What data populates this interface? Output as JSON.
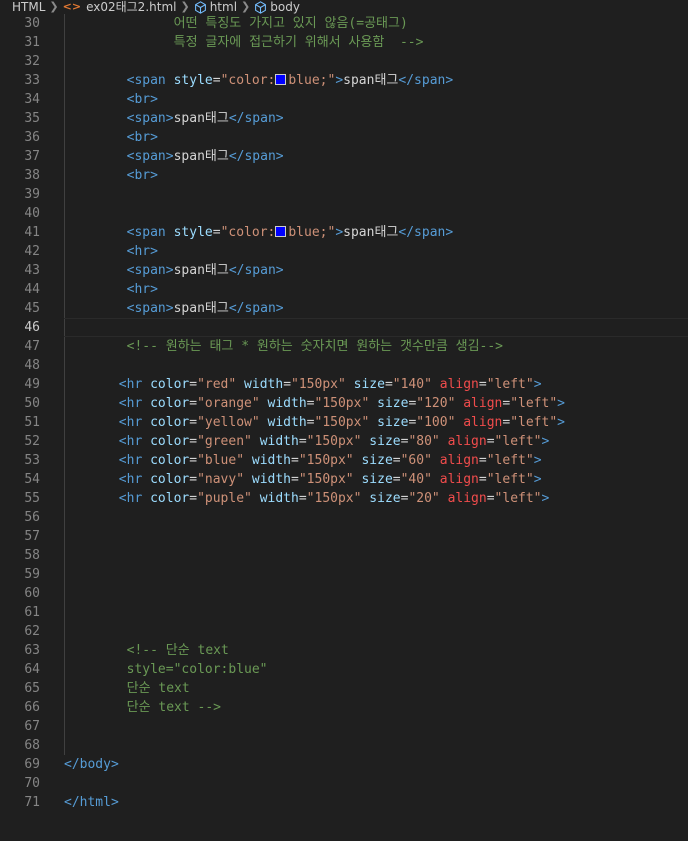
{
  "breadcrumb": {
    "items": [
      "HTML",
      "ex02태그2.html",
      "html",
      "body"
    ]
  },
  "colors": {
    "background": "#1f1f1f",
    "tag": "#569cd6",
    "attribute": "#9cdcfe",
    "string": "#ce9178",
    "invalid_attribute": "#f14c4c",
    "comment": "#6a9955",
    "swatch_blue": "#0000ff"
  },
  "editor": {
    "current_line": 46,
    "lines": [
      {
        "n": "30",
        "indent": 14,
        "tokens": [
          {
            "t": "어떤 특징도 가지고 있지 않음(=공태그)",
            "c": "cmt"
          }
        ]
      },
      {
        "n": "31",
        "indent": 14,
        "tokens": [
          {
            "t": "특정 글자에 접근하기 위해서 사용함  -->",
            "c": "cmt"
          }
        ]
      },
      {
        "n": "32",
        "indent": 0,
        "tokens": []
      },
      {
        "n": "33",
        "indent": 8,
        "tokens": [
          {
            "t": "<span",
            "c": "tag"
          },
          {
            "t": " "
          },
          {
            "t": "style",
            "c": "attr"
          },
          {
            "t": "=",
            "c": "txt"
          },
          {
            "t": "\"color:",
            "c": "str"
          },
          {
            "t": "",
            "c": "swatch"
          },
          {
            "t": "blue;\"",
            "c": "str"
          },
          {
            "t": ">",
            "c": "tag"
          },
          {
            "t": "span태그",
            "c": "txt"
          },
          {
            "t": "</span>",
            "c": "tag"
          }
        ]
      },
      {
        "n": "34",
        "indent": 8,
        "tokens": [
          {
            "t": "<br>",
            "c": "tag"
          }
        ]
      },
      {
        "n": "35",
        "indent": 8,
        "tokens": [
          {
            "t": "<span>",
            "c": "tag"
          },
          {
            "t": "span태그",
            "c": "txt"
          },
          {
            "t": "</span>",
            "c": "tag"
          }
        ]
      },
      {
        "n": "36",
        "indent": 8,
        "tokens": [
          {
            "t": "<br>",
            "c": "tag"
          }
        ]
      },
      {
        "n": "37",
        "indent": 8,
        "tokens": [
          {
            "t": "<span>",
            "c": "tag"
          },
          {
            "t": "span태그",
            "c": "txt"
          },
          {
            "t": "</span>",
            "c": "tag"
          }
        ]
      },
      {
        "n": "38",
        "indent": 8,
        "tokens": [
          {
            "t": "<br>",
            "c": "tag"
          }
        ]
      },
      {
        "n": "39",
        "indent": 0,
        "tokens": []
      },
      {
        "n": "40",
        "indent": 0,
        "tokens": []
      },
      {
        "n": "41",
        "indent": 8,
        "tokens": [
          {
            "t": "<span",
            "c": "tag"
          },
          {
            "t": " "
          },
          {
            "t": "style",
            "c": "attr"
          },
          {
            "t": "=",
            "c": "txt"
          },
          {
            "t": "\"color:",
            "c": "str"
          },
          {
            "t": "",
            "c": "swatch"
          },
          {
            "t": "blue;\"",
            "c": "str"
          },
          {
            "t": ">",
            "c": "tag"
          },
          {
            "t": "span태그",
            "c": "txt"
          },
          {
            "t": "</span>",
            "c": "tag"
          }
        ]
      },
      {
        "n": "42",
        "indent": 8,
        "tokens": [
          {
            "t": "<hr>",
            "c": "tag"
          }
        ]
      },
      {
        "n": "43",
        "indent": 8,
        "tokens": [
          {
            "t": "<span>",
            "c": "tag"
          },
          {
            "t": "span태그",
            "c": "txt"
          },
          {
            "t": "</span>",
            "c": "tag"
          }
        ]
      },
      {
        "n": "44",
        "indent": 8,
        "tokens": [
          {
            "t": "<hr>",
            "c": "tag"
          }
        ]
      },
      {
        "n": "45",
        "indent": 8,
        "tokens": [
          {
            "t": "<span>",
            "c": "tag"
          },
          {
            "t": "span태그",
            "c": "txt"
          },
          {
            "t": "</span>",
            "c": "tag"
          }
        ]
      },
      {
        "n": "46",
        "indent": 0,
        "tokens": []
      },
      {
        "n": "47",
        "indent": 8,
        "tokens": [
          {
            "t": "<!-- 원하는 태그 * 원하는 숫자치면 원하는 갯수만큼 생김-->",
            "c": "cmt"
          }
        ]
      },
      {
        "n": "48",
        "indent": 0,
        "tokens": []
      },
      {
        "n": "49",
        "indent": 7,
        "tokens": [
          {
            "t": "<hr",
            "c": "tag"
          },
          {
            "t": " "
          },
          {
            "t": "color",
            "c": "attr"
          },
          {
            "t": "=",
            "c": "txt"
          },
          {
            "t": "\"red\"",
            "c": "str"
          },
          {
            "t": " "
          },
          {
            "t": "width",
            "c": "attr"
          },
          {
            "t": "=",
            "c": "txt"
          },
          {
            "t": "\"150px\"",
            "c": "str"
          },
          {
            "t": " "
          },
          {
            "t": "size",
            "c": "attr"
          },
          {
            "t": "=",
            "c": "txt"
          },
          {
            "t": "\"140\"",
            "c": "str"
          },
          {
            "t": " "
          },
          {
            "t": "align",
            "c": "bad"
          },
          {
            "t": "=",
            "c": "txt"
          },
          {
            "t": "\"left\"",
            "c": "str"
          },
          {
            "t": ">",
            "c": "tag"
          }
        ]
      },
      {
        "n": "50",
        "indent": 7,
        "tokens": [
          {
            "t": "<hr",
            "c": "tag"
          },
          {
            "t": " "
          },
          {
            "t": "color",
            "c": "attr"
          },
          {
            "t": "=",
            "c": "txt"
          },
          {
            "t": "\"orange\"",
            "c": "str"
          },
          {
            "t": " "
          },
          {
            "t": "width",
            "c": "attr"
          },
          {
            "t": "=",
            "c": "txt"
          },
          {
            "t": "\"150px\"",
            "c": "str"
          },
          {
            "t": " "
          },
          {
            "t": "size",
            "c": "attr"
          },
          {
            "t": "=",
            "c": "txt"
          },
          {
            "t": "\"120\"",
            "c": "str"
          },
          {
            "t": " "
          },
          {
            "t": "align",
            "c": "bad"
          },
          {
            "t": "=",
            "c": "txt"
          },
          {
            "t": "\"left\"",
            "c": "str"
          },
          {
            "t": ">",
            "c": "tag"
          }
        ]
      },
      {
        "n": "51",
        "indent": 7,
        "tokens": [
          {
            "t": "<hr",
            "c": "tag"
          },
          {
            "t": " "
          },
          {
            "t": "color",
            "c": "attr"
          },
          {
            "t": "=",
            "c": "txt"
          },
          {
            "t": "\"yellow\"",
            "c": "str"
          },
          {
            "t": " "
          },
          {
            "t": "width",
            "c": "attr"
          },
          {
            "t": "=",
            "c": "txt"
          },
          {
            "t": "\"150px\"",
            "c": "str"
          },
          {
            "t": " "
          },
          {
            "t": "size",
            "c": "attr"
          },
          {
            "t": "=",
            "c": "txt"
          },
          {
            "t": "\"100\"",
            "c": "str"
          },
          {
            "t": " "
          },
          {
            "t": "align",
            "c": "bad"
          },
          {
            "t": "=",
            "c": "txt"
          },
          {
            "t": "\"left\"",
            "c": "str"
          },
          {
            "t": ">",
            "c": "tag"
          }
        ]
      },
      {
        "n": "52",
        "indent": 7,
        "tokens": [
          {
            "t": "<hr",
            "c": "tag"
          },
          {
            "t": " "
          },
          {
            "t": "color",
            "c": "attr"
          },
          {
            "t": "=",
            "c": "txt"
          },
          {
            "t": "\"green\"",
            "c": "str"
          },
          {
            "t": " "
          },
          {
            "t": "width",
            "c": "attr"
          },
          {
            "t": "=",
            "c": "txt"
          },
          {
            "t": "\"150px\"",
            "c": "str"
          },
          {
            "t": " "
          },
          {
            "t": "size",
            "c": "attr"
          },
          {
            "t": "=",
            "c": "txt"
          },
          {
            "t": "\"80\"",
            "c": "str"
          },
          {
            "t": " "
          },
          {
            "t": "align",
            "c": "bad"
          },
          {
            "t": "=",
            "c": "txt"
          },
          {
            "t": "\"left\"",
            "c": "str"
          },
          {
            "t": ">",
            "c": "tag"
          }
        ]
      },
      {
        "n": "53",
        "indent": 7,
        "tokens": [
          {
            "t": "<hr",
            "c": "tag"
          },
          {
            "t": " "
          },
          {
            "t": "color",
            "c": "attr"
          },
          {
            "t": "=",
            "c": "txt"
          },
          {
            "t": "\"blue\"",
            "c": "str"
          },
          {
            "t": " "
          },
          {
            "t": "width",
            "c": "attr"
          },
          {
            "t": "=",
            "c": "txt"
          },
          {
            "t": "\"150px\"",
            "c": "str"
          },
          {
            "t": " "
          },
          {
            "t": "size",
            "c": "attr"
          },
          {
            "t": "=",
            "c": "txt"
          },
          {
            "t": "\"60\"",
            "c": "str"
          },
          {
            "t": " "
          },
          {
            "t": "align",
            "c": "bad"
          },
          {
            "t": "=",
            "c": "txt"
          },
          {
            "t": "\"left\"",
            "c": "str"
          },
          {
            "t": ">",
            "c": "tag"
          }
        ]
      },
      {
        "n": "54",
        "indent": 7,
        "tokens": [
          {
            "t": "<hr",
            "c": "tag"
          },
          {
            "t": " "
          },
          {
            "t": "color",
            "c": "attr"
          },
          {
            "t": "=",
            "c": "txt"
          },
          {
            "t": "\"navy\"",
            "c": "str"
          },
          {
            "t": " "
          },
          {
            "t": "width",
            "c": "attr"
          },
          {
            "t": "=",
            "c": "txt"
          },
          {
            "t": "\"150px\"",
            "c": "str"
          },
          {
            "t": " "
          },
          {
            "t": "size",
            "c": "attr"
          },
          {
            "t": "=",
            "c": "txt"
          },
          {
            "t": "\"40\"",
            "c": "str"
          },
          {
            "t": " "
          },
          {
            "t": "align",
            "c": "bad"
          },
          {
            "t": "=",
            "c": "txt"
          },
          {
            "t": "\"left\"",
            "c": "str"
          },
          {
            "t": ">",
            "c": "tag"
          }
        ]
      },
      {
        "n": "55",
        "indent": 7,
        "tokens": [
          {
            "t": "<hr",
            "c": "tag"
          },
          {
            "t": " "
          },
          {
            "t": "color",
            "c": "attr"
          },
          {
            "t": "=",
            "c": "txt"
          },
          {
            "t": "\"puple\"",
            "c": "str"
          },
          {
            "t": " "
          },
          {
            "t": "width",
            "c": "attr"
          },
          {
            "t": "=",
            "c": "txt"
          },
          {
            "t": "\"150px\"",
            "c": "str"
          },
          {
            "t": " "
          },
          {
            "t": "size",
            "c": "attr"
          },
          {
            "t": "=",
            "c": "txt"
          },
          {
            "t": "\"20\"",
            "c": "str"
          },
          {
            "t": " "
          },
          {
            "t": "align",
            "c": "bad"
          },
          {
            "t": "=",
            "c": "txt"
          },
          {
            "t": "\"left\"",
            "c": "str"
          },
          {
            "t": ">",
            "c": "tag"
          }
        ]
      },
      {
        "n": "56",
        "indent": 0,
        "tokens": []
      },
      {
        "n": "57",
        "indent": 0,
        "tokens": []
      },
      {
        "n": "58",
        "indent": 0,
        "tokens": []
      },
      {
        "n": "59",
        "indent": 0,
        "tokens": []
      },
      {
        "n": "60",
        "indent": 0,
        "tokens": []
      },
      {
        "n": "61",
        "indent": 0,
        "tokens": []
      },
      {
        "n": "62",
        "indent": 0,
        "tokens": []
      },
      {
        "n": "63",
        "indent": 8,
        "tokens": [
          {
            "t": "<!-- 단순 text",
            "c": "cmt"
          }
        ]
      },
      {
        "n": "64",
        "indent": 8,
        "tokens": [
          {
            "t": "style=\"color:blue\"",
            "c": "cmt"
          }
        ]
      },
      {
        "n": "65",
        "indent": 8,
        "tokens": [
          {
            "t": "단순 text",
            "c": "cmt"
          }
        ]
      },
      {
        "n": "66",
        "indent": 8,
        "tokens": [
          {
            "t": "단순 text -->",
            "c": "cmt"
          }
        ]
      },
      {
        "n": "67",
        "indent": 0,
        "tokens": []
      },
      {
        "n": "68",
        "indent": 0,
        "tokens": []
      },
      {
        "n": "69",
        "indent": 0,
        "tokens": [
          {
            "t": "</body>",
            "c": "tag"
          }
        ]
      },
      {
        "n": "70",
        "indent": 0,
        "tokens": []
      },
      {
        "n": "71",
        "indent": 0,
        "tokens": [
          {
            "t": "</html>",
            "c": "tag"
          }
        ]
      }
    ]
  }
}
